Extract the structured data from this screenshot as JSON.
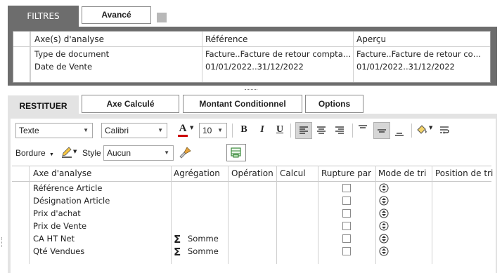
{
  "filters_section": {
    "tab_label": "FILTRES",
    "advanced_label": "Avancé",
    "columns": [
      "Axe(s) d'analyse",
      "Référence",
      "Aperçu"
    ],
    "rows": [
      {
        "axis": "Type de document",
        "reference": "Facture..Facture de retour comptabilis...",
        "preview": "Facture..Facture de retour compta..."
      },
      {
        "axis": "Date de Vente",
        "reference": "01/01/2022..31/12/2022",
        "preview": "01/01/2022..31/12/2022"
      }
    ]
  },
  "restitution_section": {
    "tab_label": "RESTITUER",
    "tabs": [
      "Axe Calculé",
      "Montant Conditionnel",
      "Options"
    ],
    "toolbar": {
      "format_value": "Texte",
      "font_value": "Calibri",
      "font_size": "10",
      "font_color_glyph": "A",
      "bold_glyph": "B",
      "italic_glyph": "I",
      "underline_glyph": "U",
      "border_label": "Bordure",
      "style_label": "Style",
      "style_value": "Aucun"
    },
    "columns": [
      "Axe d'analyse",
      "Agrégation",
      "Opération",
      "Calcul",
      "Rupture par",
      "Mode de tri",
      "Position de tri"
    ],
    "rows": [
      {
        "axis": "Référence Article",
        "aggregation": "",
        "sum_glyph": ""
      },
      {
        "axis": "Désignation Article",
        "aggregation": "",
        "sum_glyph": ""
      },
      {
        "axis": "Prix d'achat",
        "aggregation": "",
        "sum_glyph": ""
      },
      {
        "axis": "Prix de Vente",
        "aggregation": "",
        "sum_glyph": ""
      },
      {
        "axis": "CA HT Net",
        "aggregation": "Somme",
        "sum_glyph": "Σ"
      },
      {
        "axis": "Qté Vendues",
        "aggregation": "Somme",
        "sum_glyph": "Σ"
      }
    ]
  },
  "colors": {
    "dark_band": "#6d6d6d",
    "light_band": "#e3e3e3",
    "font_color_bar": "#cc0000"
  },
  "icons": [
    "dropdown-arrow-icon",
    "font-color-icon",
    "bold-icon",
    "italic-icon",
    "underline-icon",
    "align-left-icon",
    "align-center-icon",
    "align-right-icon",
    "valign-top-icon",
    "valign-middle-icon",
    "valign-bottom-icon",
    "fill-color-icon",
    "wrap-text-icon",
    "pen-icon",
    "format-painter-icon",
    "add-row-icon",
    "sort-icon"
  ]
}
